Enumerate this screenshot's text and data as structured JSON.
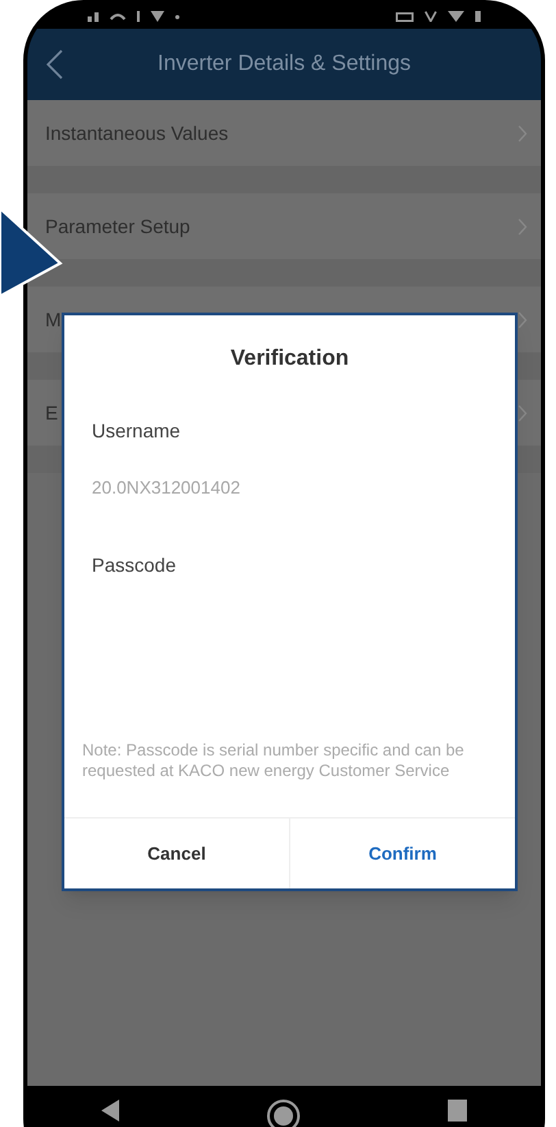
{
  "header": {
    "title": "Inverter Details & Settings"
  },
  "menu_items": [
    {
      "label": "Instantaneous Values"
    },
    {
      "label": "Parameter Setup"
    },
    {
      "label": "M"
    },
    {
      "label": "E"
    }
  ],
  "dialog": {
    "title": "Verification",
    "fields": [
      {
        "label": "Username",
        "value": "20.0NX312001402"
      },
      {
        "label": "Passcode"
      }
    ],
    "note": "Note: Passcode is serial number specific and can be requested at KACO new energy Customer Service",
    "buttons": [
      {
        "label": "Cancel",
        "kind": "secondary"
      },
      {
        "label": "Confirm",
        "kind": "primary"
      }
    ]
  }
}
